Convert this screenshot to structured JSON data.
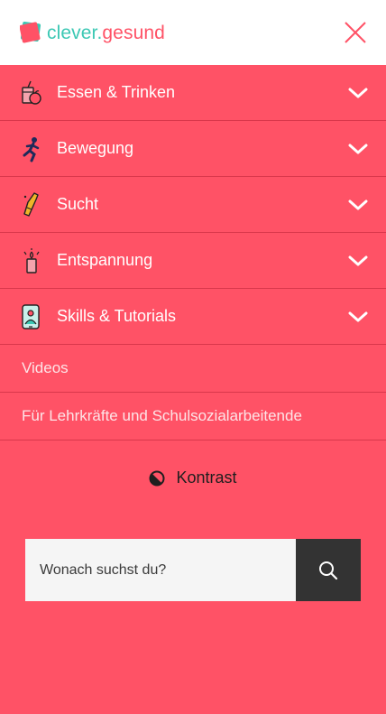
{
  "header": {
    "logo": {
      "part1": "clever",
      "dot": ".",
      "part2": "gesund"
    },
    "close_icon": "close-icon"
  },
  "menu": [
    {
      "label": "Essen & Trinken",
      "icon": "drink-apple-icon"
    },
    {
      "label": "Bewegung",
      "icon": "running-person-icon"
    },
    {
      "label": "Sucht",
      "icon": "bottle-icon"
    },
    {
      "label": "Entspannung",
      "icon": "candle-icon"
    },
    {
      "label": "Skills & Tutorials",
      "icon": "phone-person-icon"
    }
  ],
  "links": [
    {
      "label": "Videos"
    },
    {
      "label": "Für Lehrkräfte und Schulsozialarbeitende"
    }
  ],
  "contrast": {
    "label": "Kontrast",
    "icon": "contrast-icon"
  },
  "search": {
    "placeholder": "Wonach suchst du?",
    "icon": "search-icon"
  },
  "colors": {
    "brand": "#ff5266",
    "teal": "#3cc8b4",
    "divider": "#d9374b",
    "search_button": "#333333"
  }
}
